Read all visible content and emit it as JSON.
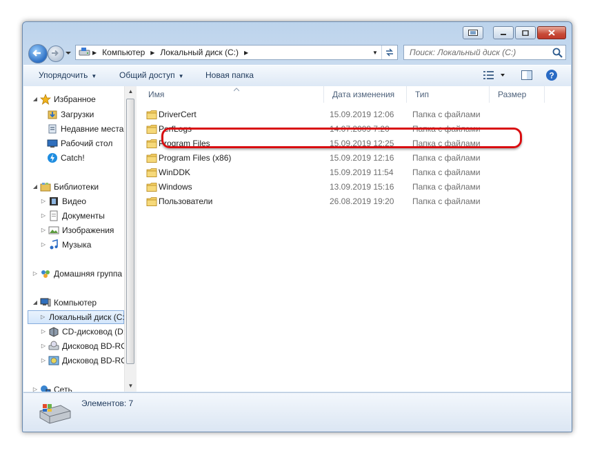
{
  "address": {
    "segments": [
      "Компьютер",
      "Локальный диск (C:)"
    ]
  },
  "search": {
    "placeholder": "Поиск: Локальный диск (C:)"
  },
  "toolbar": {
    "organize": "Упорядочить",
    "share": "Общий доступ",
    "new_folder": "Новая папка"
  },
  "sidebar": {
    "favorites": {
      "label": "Избранное",
      "items": [
        "Загрузки",
        "Недавние места",
        "Рабочий стол",
        "Catch!"
      ]
    },
    "libraries": {
      "label": "Библиотеки",
      "items": [
        "Видео",
        "Документы",
        "Изображения",
        "Музыка"
      ]
    },
    "homegroup": "Домашняя группа",
    "computer": {
      "label": "Компьютер",
      "items": [
        "Локальный диск (C:)",
        "CD-дисковод (D:)",
        "Дисковод BD-ROM",
        "Дисковод BD-ROM"
      ]
    },
    "network": "Сеть"
  },
  "columns": {
    "name": "Имя",
    "date": "Дата изменения",
    "type": "Тип",
    "size": "Размер"
  },
  "files": [
    {
      "name": "DriverCert",
      "date": "15.09.2019 12:06",
      "type": "Папка с файлами"
    },
    {
      "name": "PerfLogs",
      "date": "14.07.2009 7:20",
      "type": "Папка с файлами"
    },
    {
      "name": "Program Files",
      "date": "15.09.2019 12:25",
      "type": "Папка с файлами"
    },
    {
      "name": "Program Files (x86)",
      "date": "15.09.2019 12:16",
      "type": "Папка с файлами"
    },
    {
      "name": "WinDDK",
      "date": "15.09.2019 11:54",
      "type": "Папка с файлами"
    },
    {
      "name": "Windows",
      "date": "13.09.2019 15:16",
      "type": "Папка с файлами"
    },
    {
      "name": "Пользователи",
      "date": "26.08.2019 19:20",
      "type": "Папка с файлами"
    }
  ],
  "status": {
    "items_count": "Элементов: 7"
  },
  "colors": {
    "highlight": "#d90d10",
    "accent": "#1e395b"
  }
}
